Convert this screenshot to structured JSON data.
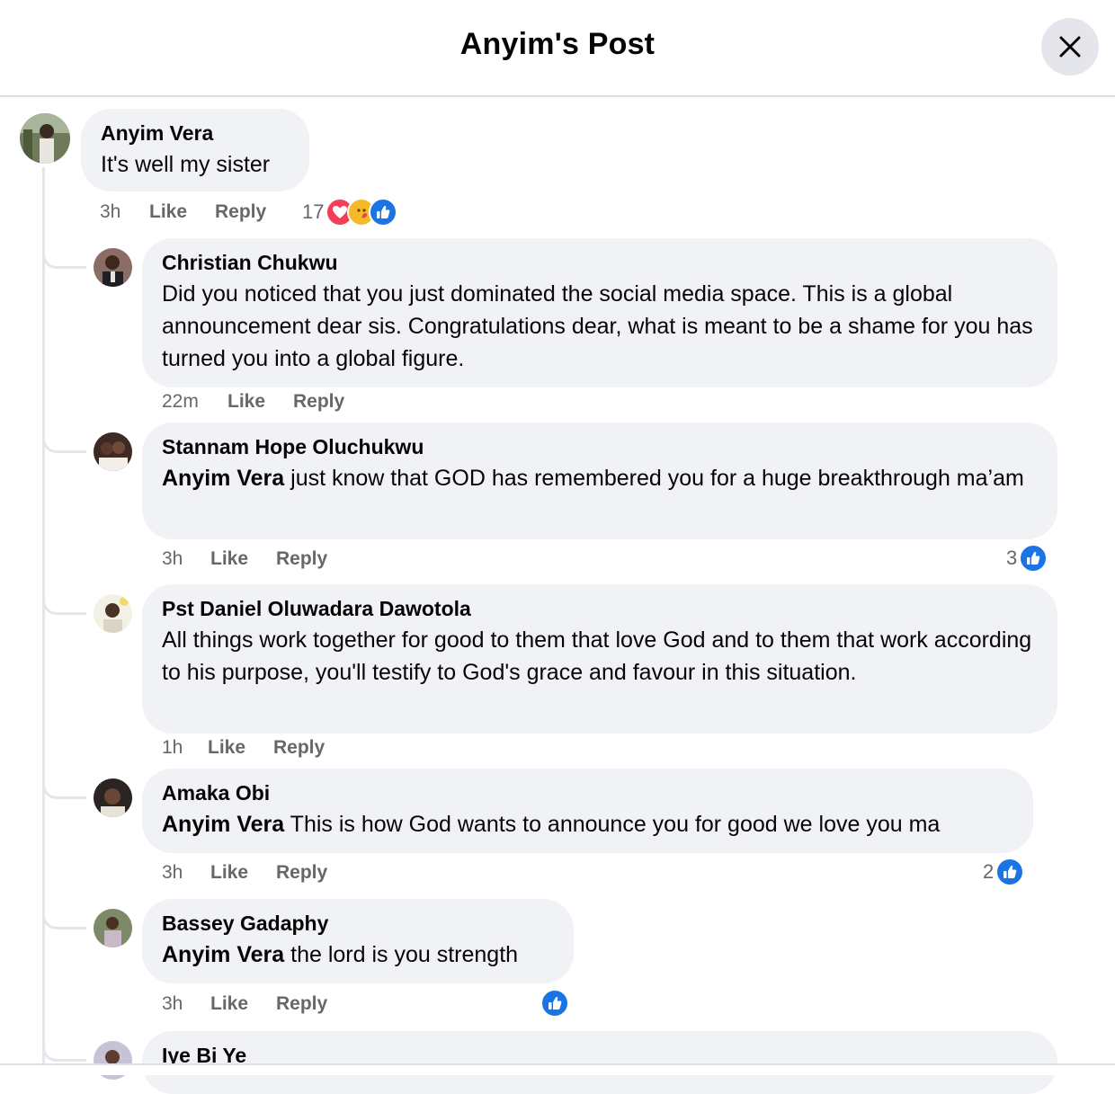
{
  "header": {
    "title": "Anyim's Post",
    "close_icon": "close-icon"
  },
  "colors": {
    "bubble": "#f0f2f5",
    "meta_text": "#65676b",
    "like_blue": "#1b74e4",
    "love_red": "#f33e58",
    "care_yellow": "#f7b928"
  },
  "parent": {
    "author": "Anyim Vera",
    "text": "It's well my sister",
    "time": "3h",
    "like_label": "Like",
    "reply_label": "Reply",
    "reaction_count": "17",
    "reactions": [
      "love",
      "care",
      "like"
    ]
  },
  "replies": [
    {
      "author": "Christian Chukwu",
      "mention": "",
      "text": "Did you noticed that you just dominated the social media space. This is a global announcement dear sis. Congratulations dear, what is meant to be a shame for you has turned you into a global figure.",
      "time": "22m",
      "like_label": "Like",
      "reply_label": "Reply",
      "reaction_count": ""
    },
    {
      "author": "Stannam Hope Oluchukwu",
      "mention": "Anyim Vera",
      "text": " just know that GOD has remembered you for a huge breakthrough ma’am",
      "time": "3h",
      "like_label": "Like",
      "reply_label": "Reply",
      "reaction_count": "3"
    },
    {
      "author": "Pst Daniel Oluwadara Dawotola",
      "mention": "",
      "text": "All things work together for good to them that love God and to them that work according to his purpose, you'll testify to God's grace and favour in this situation.",
      "time": "1h",
      "like_label": "Like",
      "reply_label": "Reply",
      "reaction_count": ""
    },
    {
      "author": "Amaka Obi",
      "mention": "Anyim Vera",
      "text": " This is how God wants to announce you for good we love you ma",
      "time": "3h",
      "like_label": "Like",
      "reply_label": "Reply",
      "reaction_count": "2"
    },
    {
      "author": "Bassey Gadaphy",
      "mention": "Anyim Vera",
      "text": " the lord is you strength",
      "time": "3h",
      "like_label": "Like",
      "reply_label": "Reply",
      "reaction_count": ""
    },
    {
      "author": "Iye Bi Ye",
      "mention": "",
      "text": "",
      "time": "",
      "like_label": "",
      "reply_label": "",
      "reaction_count": ""
    }
  ]
}
